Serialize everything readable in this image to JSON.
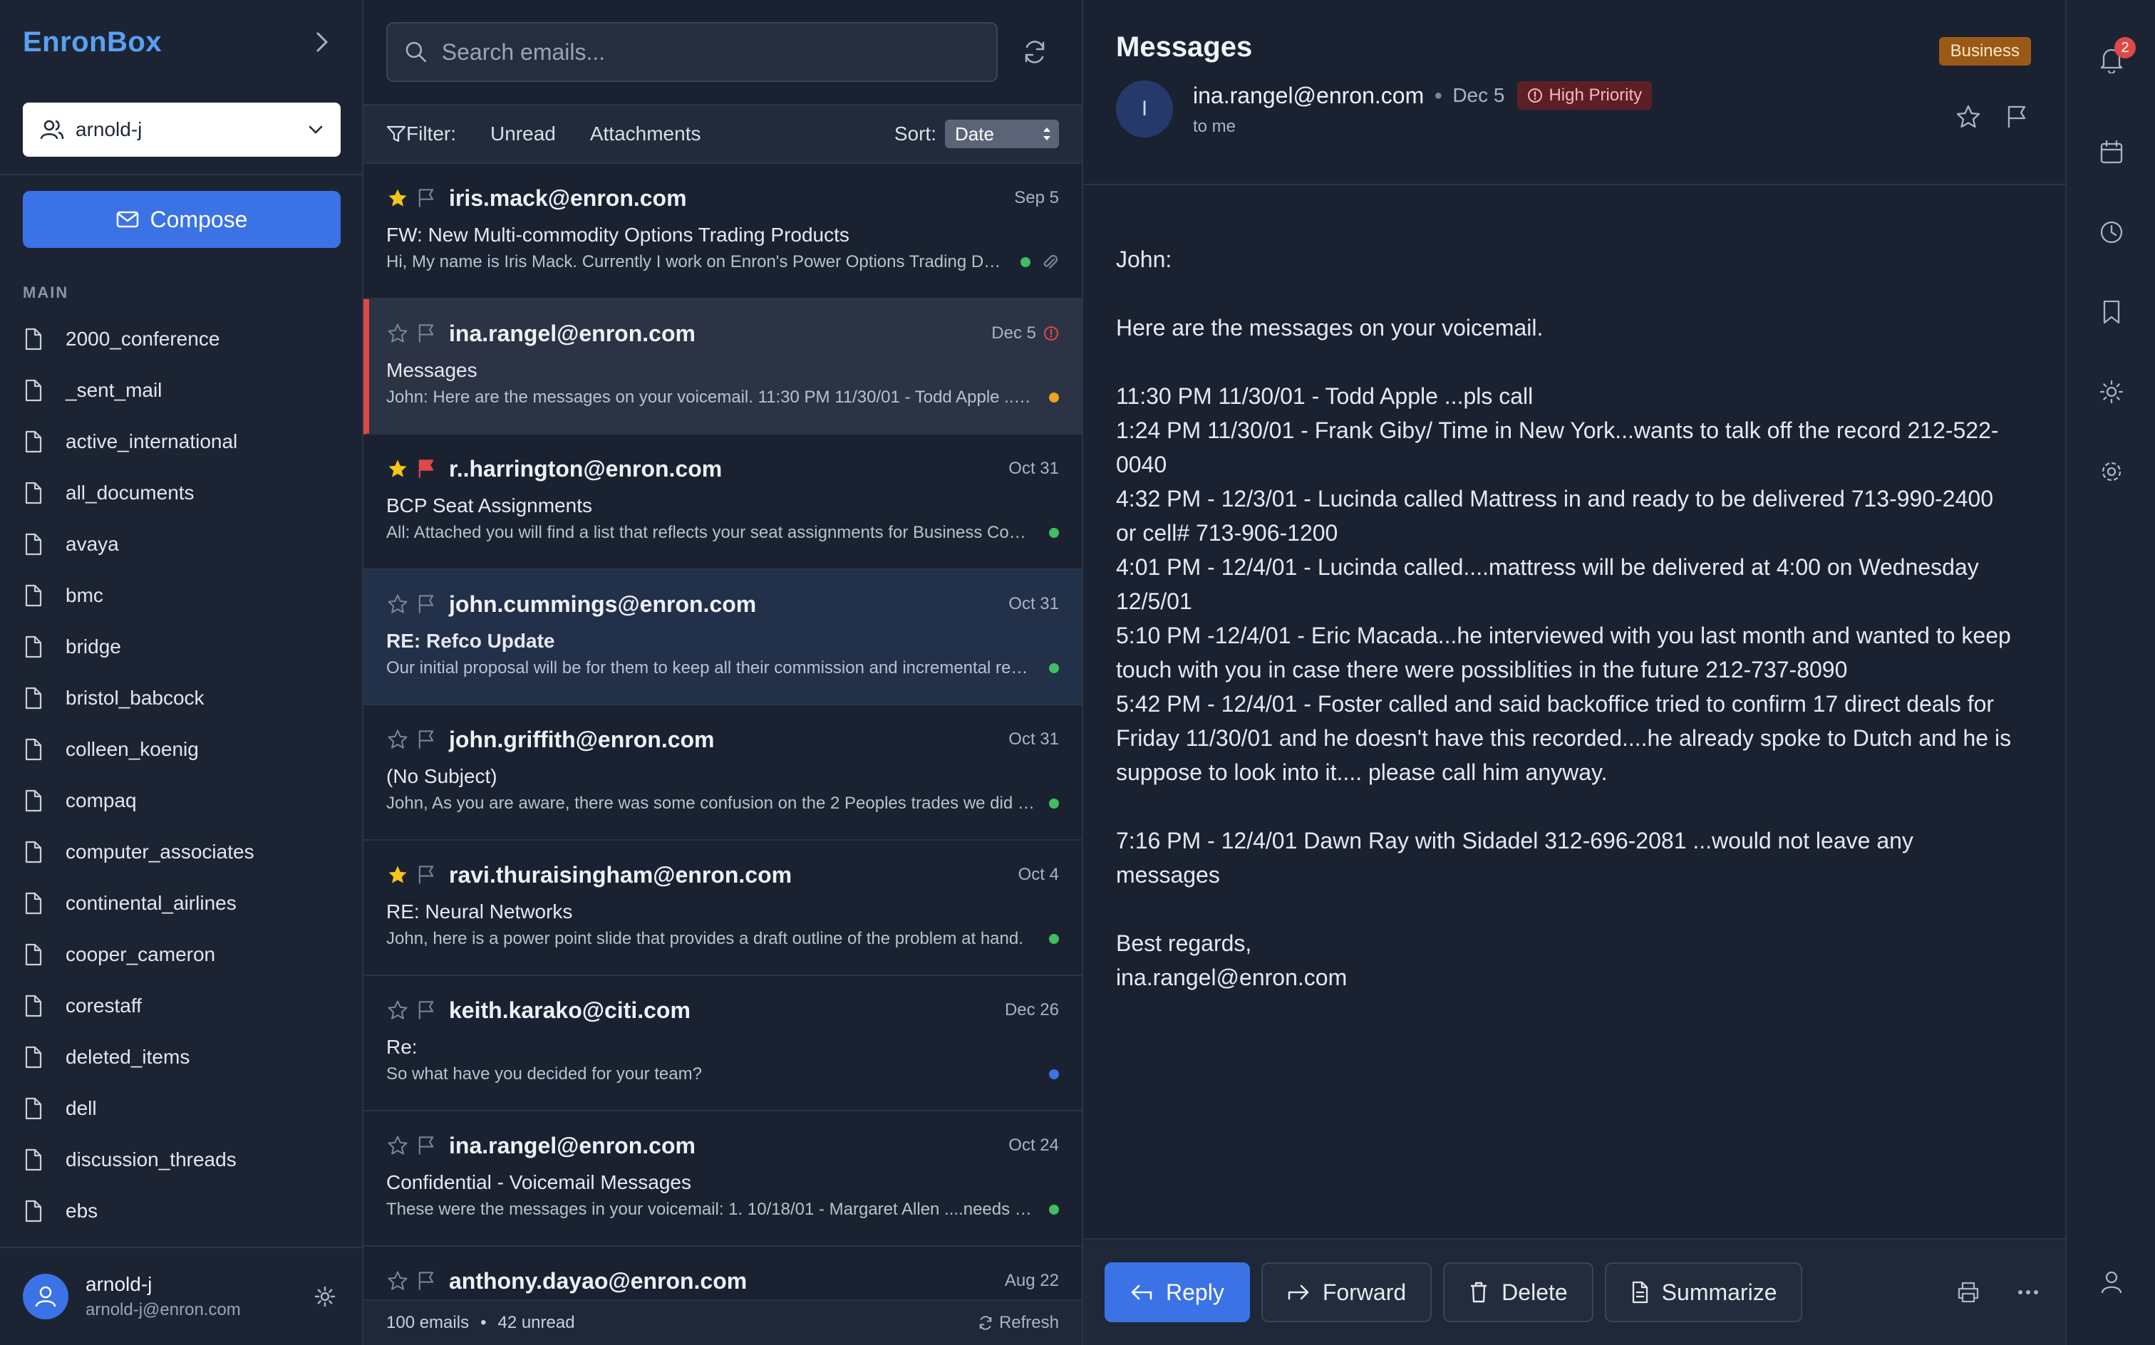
{
  "app": {
    "brand": "EnronBox"
  },
  "sidebar": {
    "account": "arnold-j",
    "compose_label": "Compose",
    "section_label": "MAIN",
    "folders": [
      "2000_conference",
      "_sent_mail",
      "active_international",
      "all_documents",
      "avaya",
      "bmc",
      "bridge",
      "bristol_babcock",
      "colleen_koenig",
      "compaq",
      "computer_associates",
      "continental_airlines",
      "cooper_cameron",
      "corestaff",
      "deleted_items",
      "dell",
      "discussion_threads",
      "ebs"
    ],
    "user": {
      "name": "arnold-j",
      "email": "arnold-j@enron.com"
    }
  },
  "list": {
    "search_placeholder": "Search emails...",
    "filter_label": "Filter:",
    "filter_unread": "Unread",
    "filter_attachments": "Attachments",
    "sort_label": "Sort:",
    "sort_value": "Date",
    "emails": [
      {
        "sender": "iris.mack@enron.com",
        "date": "Sep 5",
        "subject": "FW: New Multi-commodity Options Trading Products",
        "preview": "Hi, My name is Iris Mack. Currently I work on Enron's Power Options Trading Desk as a quantitative analyst and structurer.",
        "starred": true,
        "flagged": false,
        "dot": "#3fbf5f",
        "attachment": true
      },
      {
        "sender": "ina.rangel@enron.com",
        "date": "Dec 5",
        "subject": "Messages",
        "preview": "John: Here are the messages on your voicemail. 11:30 PM 11/30/01 - Todd Apple ...pls call",
        "starred": false,
        "flagged": false,
        "dot": "#f0a020",
        "priority": true
      },
      {
        "sender": "r..harrington@enron.com",
        "date": "Oct 31",
        "subject": "BCP Seat Assignments",
        "preview": "All: Attached you will find a list that reflects your seat assignments for Business Continuity Planning.",
        "starred": true,
        "flagged": true,
        "dot": "#3fbf5f"
      },
      {
        "sender": "john.cummings@enron.com",
        "date": "Oct 31",
        "subject": "RE: Refco Update",
        "preview": "Our initial proposal will be for them to keep all their commission and incremental revenue.",
        "starred": false,
        "flagged": false,
        "dot": "#3fbf5f",
        "bold_subject": true
      },
      {
        "sender": "john.griffith@enron.com",
        "date": "Oct 31",
        "subject": "(No Subject)",
        "preview": "John, As you are aware, there was some confusion on the 2 Peoples trades we did yesterday.",
        "starred": false,
        "flagged": false,
        "dot": "#3fbf5f"
      },
      {
        "sender": "ravi.thuraisingham@enron.com",
        "date": "Oct 4",
        "subject": "RE: Neural Networks",
        "preview": "John, here is a power point slide that provides a draft outline of the problem at hand.",
        "starred": true,
        "flagged": false,
        "dot": "#3fbf5f"
      },
      {
        "sender": "keith.karako@citi.com",
        "date": "Dec 26",
        "subject": "Re:",
        "preview": "So what have you decided for your team?",
        "starred": false,
        "flagged": false,
        "dot": "#3b73e6"
      },
      {
        "sender": "ina.rangel@enron.com",
        "date": "Oct 24",
        "subject": "Confidential - Voicemail Messages",
        "preview": "These were the messages in your voicemail: 1. 10/18/01 - Margaret Allen ....needs to talk to you",
        "starred": false,
        "flagged": false,
        "dot": "#3fbf5f"
      },
      {
        "sender": "anthony.dayao@enron.com",
        "date": "Aug 22",
        "subject": "",
        "preview": "",
        "starred": false,
        "flagged": false,
        "dot": ""
      }
    ],
    "footer": {
      "count": "100 emails",
      "unread": "42 unread",
      "refresh": "Refresh"
    }
  },
  "message": {
    "title": "Messages",
    "category": "Business",
    "from_initial": "I",
    "from": "ina.rangel@enron.com",
    "date": "Dec 5",
    "priority": "High Priority",
    "to": "to me",
    "body": [
      [
        "John:"
      ],
      [
        "Here are the messages on your voicemail."
      ],
      [
        "11:30 PM 11/30/01 - Todd Apple ...pls call",
        "1:24 PM 11/30/01 - Frank Giby/ Time in New York...wants to talk off the record 212-522-",
        "0040",
        "4:32 PM - 12/3/01 - Lucinda called Mattress in and ready to be delivered 713-990-2400",
        "or cell# 713-906-1200",
        "4:01 PM - 12/4/01 - Lucinda called....mattress will be delivered at 4:00 on Wednesday",
        "12/5/01",
        "5:10 PM -12/4/01 - Eric Macada...he interviewed with you last month and wanted to keep",
        "touch with you in case there were possiblities in the future 212-737-8090",
        "5:42 PM - 12/4/01 - Foster called and said backoffice tried to confirm 17 direct deals for",
        "Friday 11/30/01 and he doesn't have this recorded....he already spoke to Dutch and he is",
        "suppose to look into it.... please call him anyway."
      ],
      [
        "7:16 PM - 12/4/01 Dawn Ray with Sidadel 312-696-2081 ...would not leave any",
        "messages"
      ],
      [
        "Best regards,",
        "ina.rangel@enron.com"
      ]
    ],
    "actions": {
      "reply": "Reply",
      "forward": "Forward",
      "delete": "Delete",
      "summarize": "Summarize"
    }
  },
  "rail": {
    "notification_count": "2"
  },
  "colors": {
    "accent": "#3b73e6",
    "priority": "#e04848",
    "badge_business": "#9a5a16"
  }
}
